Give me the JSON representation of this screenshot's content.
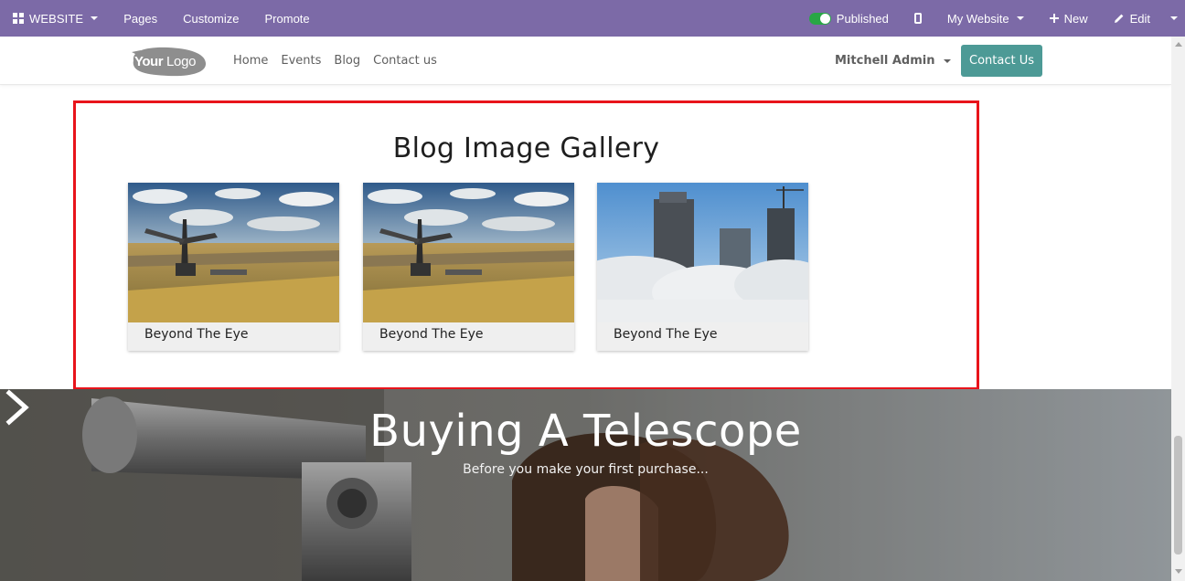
{
  "admin_bar": {
    "website_label": "WEBSITE",
    "pages_label": "Pages",
    "customize_label": "Customize",
    "promote_label": "Promote",
    "published_label": "Published",
    "my_website_label": "My Website",
    "new_label": "New",
    "edit_label": "Edit",
    "bar_color": "#7c6aa7"
  },
  "header": {
    "logo_text": "YourLogo",
    "nav": [
      "Home",
      "Events",
      "Blog",
      "Contact us"
    ],
    "user_name": "Mitchell Admin",
    "contact_button": "Contact Us",
    "contact_button_color": "#4d9a96"
  },
  "gallery": {
    "title": "Blog Image Gallery",
    "highlight_color": "#e8141b",
    "cards": [
      {
        "caption": "Beyond The Eye",
        "image": "mining-excavator"
      },
      {
        "caption": "Beyond The Eye",
        "image": "mining-excavator"
      },
      {
        "caption": "Beyond The Eye",
        "image": "skyscrapers-in-fog"
      }
    ]
  },
  "hero": {
    "title": "Buying A Telescope",
    "subtitle": "Before you make your first purchase..."
  }
}
